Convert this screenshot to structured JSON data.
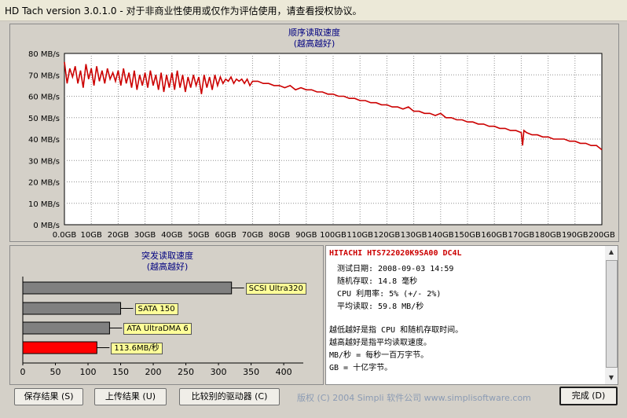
{
  "window": {
    "title": "HD Tach version 3.0.1.0  - 对于非商业性使用或仅作为评估使用，请查看授权协议。"
  },
  "seq_chart": {
    "title": "顺序读取速度",
    "subtitle": "(越高越好)"
  },
  "burst_chart": {
    "title": "突发读取速度",
    "subtitle": "(越高越好)"
  },
  "chart_data": [
    {
      "type": "line",
      "title": "顺序读取速度",
      "subtitle": "(越高越好)",
      "y_tick_labels": [
        "0 MB/s",
        "10 MB/s",
        "20 MB/s",
        "30 MB/s",
        "40 MB/s",
        "50 MB/s",
        "60 MB/s",
        "70 MB/s",
        "80 MB/s"
      ],
      "x_tick_labels": [
        "0.0GB",
        "10GB",
        "20GB",
        "30GB",
        "40GB",
        "50GB",
        "60GB",
        "70GB",
        "80GB",
        "90GB",
        "100GB",
        "110GB",
        "120GB",
        "130GB",
        "140GB",
        "150GB",
        "160GB",
        "170GB",
        "180GB",
        "190GB",
        "200GB"
      ],
      "ylim": [
        0,
        80
      ],
      "xlim": [
        0,
        200
      ],
      "grid": true,
      "series_color": "#cc0000",
      "series": [
        {
          "x": [
            0,
            1,
            2,
            3,
            4,
            5,
            6,
            7,
            8,
            9,
            10,
            11,
            12,
            13,
            14,
            15,
            16,
            17,
            18,
            19,
            20,
            21,
            22,
            23,
            24,
            25,
            26,
            27,
            28,
            29,
            30,
            31,
            32,
            33,
            34,
            35,
            36,
            37,
            38,
            39,
            40,
            41,
            42,
            43,
            44,
            45,
            46,
            47,
            48,
            49,
            50,
            51,
            52,
            53,
            54,
            55,
            56,
            57,
            58,
            59,
            60,
            61,
            62,
            63,
            64,
            65,
            66,
            67,
            68,
            69,
            70,
            72,
            74,
            76,
            78,
            80,
            82,
            84,
            86,
            88,
            90,
            92,
            94,
            96,
            98,
            100,
            102,
            104,
            106,
            108,
            110,
            112,
            114,
            116,
            118,
            120,
            122,
            124,
            126,
            128,
            130,
            132,
            134,
            136,
            138,
            140,
            142,
            144,
            146,
            148,
            150,
            152,
            154,
            156,
            158,
            160,
            162,
            164,
            166,
            168,
            170,
            170.5,
            171,
            172,
            174,
            176,
            178,
            180,
            182,
            184,
            186,
            188,
            190,
            192,
            194,
            196,
            198,
            199,
            200
          ],
          "y": [
            76,
            66,
            73,
            69,
            74,
            66,
            72,
            64,
            75,
            68,
            73,
            65,
            74,
            67,
            72,
            66,
            73,
            68,
            71,
            67,
            72,
            65,
            73,
            66,
            71,
            64,
            72,
            63,
            70,
            65,
            71,
            64,
            72,
            65,
            70,
            63,
            71,
            62,
            70,
            64,
            71,
            63,
            72,
            64,
            70,
            62,
            69,
            64,
            70,
            65,
            69,
            61,
            70,
            64,
            69,
            63,
            70,
            65,
            69,
            66,
            68,
            67,
            69,
            66,
            68,
            67,
            68,
            66,
            68,
            65,
            67,
            67,
            66,
            66,
            65,
            65,
            64,
            65,
            63,
            64,
            63,
            63,
            62,
            62,
            61,
            61,
            60,
            60,
            59,
            59,
            58,
            58,
            57,
            57,
            56,
            56,
            55,
            55,
            54,
            55,
            53,
            53,
            52,
            52,
            51,
            52,
            50,
            50,
            49,
            49,
            48,
            48,
            47,
            47,
            46,
            46,
            45,
            45,
            44,
            44,
            43,
            37,
            44,
            43,
            42,
            42,
            41,
            41,
            40,
            40,
            40,
            39,
            39,
            38,
            38,
            37,
            37,
            36,
            35
          ]
        }
      ]
    },
    {
      "type": "bar",
      "title": "突发读取速度",
      "subtitle": "(越高越好)",
      "orientation": "horizontal",
      "x_tick_labels": [
        "0",
        "50",
        "100",
        "150",
        "200",
        "250",
        "300",
        "350",
        "400"
      ],
      "xlim": [
        0,
        430
      ],
      "grid": false,
      "categories": [
        "SCSI Ultra320",
        "SATA 150",
        "ATA UltraDMA 6",
        "113.6MB/秒"
      ],
      "values": [
        320,
        150,
        133,
        113.6
      ],
      "colors": [
        "#808080",
        "#808080",
        "#808080",
        "#ff0000"
      ]
    }
  ],
  "info": {
    "drive": "HITACHI HTS722020K9SA00 DC4L",
    "date_line": "测试日期: 2008-09-03    14:59",
    "random_line": "随机存取: 14.8 毫秒",
    "cpu_line": "CPU 利用率: 5% (+/- 2%)",
    "avg_line": "平均读取: 59.8 MB/秒",
    "note1": "越低越好是指 CPU 和随机存取时间。",
    "note2": "越高越好是指平均读取速度。",
    "note3": "MB/秒 = 每秒一百万字节。",
    "note4": "GB = 十亿字节。"
  },
  "buttons": {
    "save": "保存结果 (S)",
    "upload": "上传结果 (U)",
    "compare": "比较别的驱动器 (C)",
    "done": "完成 (D)"
  },
  "copyright": "版权 (C) 2004 Simpli 软件公司 www.simplisoftware.com"
}
